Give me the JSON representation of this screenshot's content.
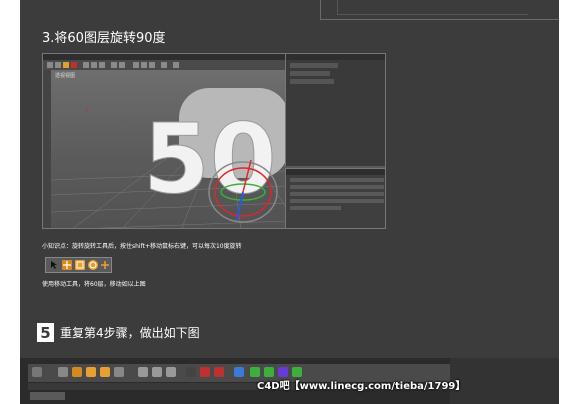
{
  "step3": {
    "title": "3.将60图层旋转90度"
  },
  "viewport": {
    "label": "透视视图",
    "object_text": "50",
    "axis_colors": {
      "x": "#e0252a",
      "y": "#3bb13b",
      "z": "#2a5ad8"
    }
  },
  "tip": {
    "text": "小知识点：旋转旋转工具后，按住shift+移动鼠标右键，可以每次10度旋转"
  },
  "toolbar_icons": [
    "cursor-icon",
    "move-icon",
    "scale-icon",
    "rotate-icon",
    "plus-icon"
  ],
  "move_tip": {
    "text": "使用移动工具，将60层，移动如以上图"
  },
  "step5": {
    "number": "5",
    "text": "重复第4步骤，做出如下图"
  },
  "watermark": {
    "text": "C4D吧【www.linecg.com/tieba/1799】"
  },
  "colors": {
    "page_bg": "#3c3c3c",
    "accent_orange": "#f0a030",
    "accent_red": "#e0252a"
  }
}
